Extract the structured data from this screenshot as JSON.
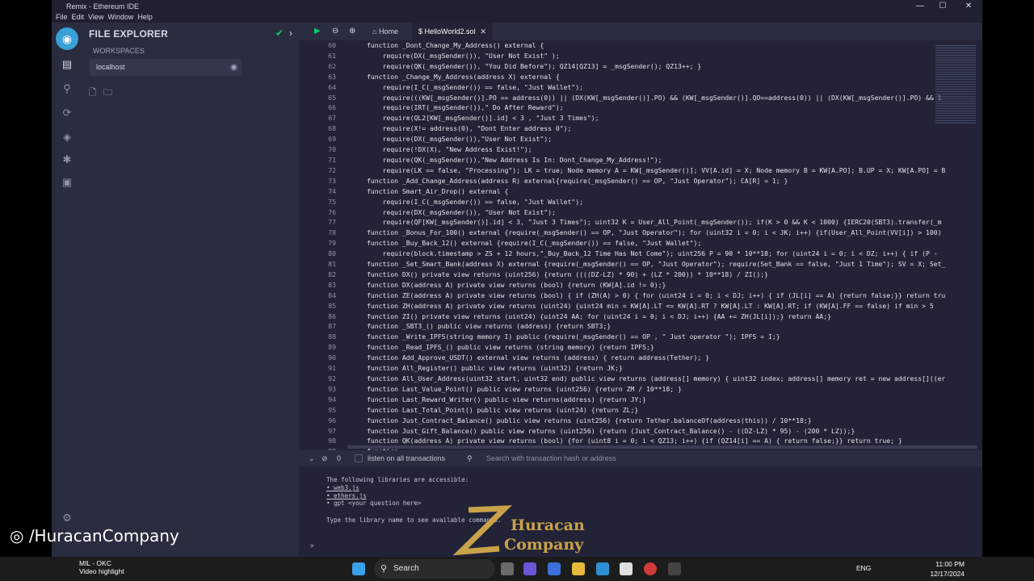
{
  "window": {
    "title": "Remix - Ethereum IDE",
    "min": "—",
    "max": "☐",
    "close": "✕"
  },
  "menu": [
    "File",
    "Edit",
    "View",
    "Window",
    "Help"
  ],
  "sidebar": {
    "title": "FILE EXPLORER",
    "workspaces_label": "WORKSPACES",
    "workspace": "localhost"
  },
  "tabs": {
    "home": "Home",
    "file": "HelloWorld2.sol"
  },
  "code": [
    {
      "n": "60",
      "t": "function _Dont_Change_My_Address() external {"
    },
    {
      "n": "61",
      "t": "    require(DX(_msgSender()), \"User Not Exist\" );"
    },
    {
      "n": "62",
      "t": "    require(QK(_msgSender()), \"You Did Before\"); QZ14[QZ13] = _msgSender(); QZ13++; }"
    },
    {
      "n": "63",
      "t": "function _Change_My_Address(address X) external {"
    },
    {
      "n": "64",
      "t": "    require(I_C(_msgSender()) == false, \"Just Wallet\");"
    },
    {
      "n": "65",
      "t": "    require(((KW[_msgSender()].PO == address(0)) || (DX(KW[_msgSender()].PO) && (KW[_msgSender()].QO==address(0)) || (DX(KW[_msgSender()].PO) && I"
    },
    {
      "n": "66",
      "t": "    require(IRT(_msgSender()),\" Do After Reward\");"
    },
    {
      "n": "67",
      "t": "    require(QL2[KW[_msgSender()].id] < 3 , \"Just 3 Times\");"
    },
    {
      "n": "68",
      "t": "    require(X!= address(0), \"Dont Enter address 0\");"
    },
    {
      "n": "69",
      "t": "    require(DX(_msgSender()),\"User Not Exist\");"
    },
    {
      "n": "70",
      "t": "    require(!DX(X), \"New Address Exist!\");"
    },
    {
      "n": "71",
      "t": "    require(QK(_msgSender()),\"New Address Is In: Dont_Change_My_Address!\");"
    },
    {
      "n": "72",
      "t": "    require(LK == false, \"Processing\"); LK = true; Node memory A = KW[_msgSender()]; VV[A.id] = X; Node memory B = KW[A.PO]; B.UP = X; KW[A.PO] = B"
    },
    {
      "n": "73",
      "t": "function _Add_Change_Address(address R) external{require(_msgSender() == OP, \"Just Operator\"); CA[R] = 1; }"
    },
    {
      "n": "74",
      "t": "function Smart_Air_Drop() external {"
    },
    {
      "n": "75",
      "t": "    require(I_C(_msgSender()) == false, \"Just Wallet\");"
    },
    {
      "n": "76",
      "t": "    require(DX(_msgSender()), \"User Not Exist\");"
    },
    {
      "n": "77",
      "t": "    require(QF[KW[_msgSender()].id] < 3, \"Just 3 Times\"); uint32 K = User_All_Point(_msgSender()); if(K > 0 && K < 1000) {IERC20(SBT3).transfer(_m"
    },
    {
      "n": "78",
      "t": "function _Bonus_For_100() external {require(_msgSender() == OP, \"Just Operator\"); for (uint32 i = 0; i < JK; i++) {if(User_All_Point(VV[i]) > 100)"
    },
    {
      "n": "79",
      "t": "function _Buy_Back_12() external {require(I_C(_msgSender()) == false, \"Just Wallet\");"
    },
    {
      "n": "80",
      "t": "    require(block.timestamp > ZS + 12 hours,\"_Buy_Back_12 Time Has Not Come\"); uint256 P = 90 * 10**18; for (uint24 i = 0; i < DZ; i++) { if (P -"
    },
    {
      "n": "81",
      "t": "function _Set_Smart_Bank(address X) external {require(_msgSender() == OP, \"Just Operator\"); require(Set_Bank == false, \"Just 1 Time\"); SV = X; Set_"
    },
    {
      "n": "82",
      "t": "function DX() private view returns (uint256) {return ((((DZ-LZ) * 90) + (LZ * 200)) * 10**18) / ZI();}"
    },
    {
      "n": "83",
      "t": "function DX(address A) private view returns (bool) {return (KW[A].id != 0);}"
    },
    {
      "n": "84",
      "t": "function ZE(address A) private view returns (bool) { if (ZH(A) > 0) { for (uint24 i = 0; i < DJ; i++) { if (JL[i] == A) {return false;}} return tru"
    },
    {
      "n": "85",
      "t": "function ZH(address A) private view returns (uint24) {uint24 min = KW[A].LT <= KW[A].RT ? KW[A].LT : KW[A].RT; if (KW[A].FF == false) if min > 5"
    },
    {
      "n": "86",
      "t": "function ZI() private view returns (uint24) {uint24 AA; for (uint24 i = 0; i < DJ; i++) {AA += ZH(JL[i]);} return AA;}"
    },
    {
      "n": "87",
      "t": "function _SBT3_() public view returns (address) {return SBT3;}"
    },
    {
      "n": "88",
      "t": "function _Write_IPFS(string memory I) public {require(_msgSender() == OP , \" Just operator \"); IPFS = I;}"
    },
    {
      "n": "89",
      "t": "function _Read_IPFS_() public view returns (string memory) {return IPFS;}"
    },
    {
      "n": "90",
      "t": "function Add_Approve_USDT() external view returns (address) { return address(Tether); }"
    },
    {
      "n": "91",
      "t": "function All_Register() public view returns (uint32) {return JK;}"
    },
    {
      "n": "92",
      "t": "function All_User_Address(uint32 start, uint32 end) public view returns (address[] memory) { uint32 index; address[] memory ret = new address[]((er"
    },
    {
      "n": "93",
      "t": "function Last_Value_Point() public view returns (uint256) {return ZM / 10**18; }"
    },
    {
      "n": "94",
      "t": "function Last_Reward_Writer() public view returns(address) {return JY;}"
    },
    {
      "n": "95",
      "t": "function Last_Total_Point() public view returns (uint24) {return ZL;}"
    },
    {
      "n": "96",
      "t": "function Just_Contract_Balance() public view returns (uint256) {return Tether.balanceOf(address(this)) / 10**18;}"
    },
    {
      "n": "97",
      "t": "function Just_Gift_Balance() public view returns (uint256) {return (Just_Contract_Balance() - ((DZ-LZ) * 95) - (200 * LZ));}"
    },
    {
      "n": "98",
      "t": "function QK(address A) private view returns (bool) {for (uint8 i = 0; i < QZ13; i++) {if (QZ14[i] == A) { return false;}} return true; }"
    },
    {
      "n": "99",
      "t": "function ..."
    }
  ],
  "terminal_bar": {
    "count": "0",
    "listen": "listen on all transactions",
    "search": "Search with transaction hash or address"
  },
  "terminal": {
    "line1": "The following libraries are accessible:",
    "line2": "• web3.js",
    "line3": "• ethers.js",
    "line4": "• gpt <your question here>",
    "line5": "Type the library name to see available commands.",
    "prompt": ">"
  },
  "watermark": "/HuracanCompany",
  "logo": {
    "line1": "Huracan",
    "line2": "Company"
  },
  "taskbar": {
    "search": "Search",
    "notif_title": "MIL - OKC",
    "notif_sub": "Video highlight",
    "lang": "ENG",
    "time": "11:00 PM",
    "date": "12/17/2024"
  }
}
